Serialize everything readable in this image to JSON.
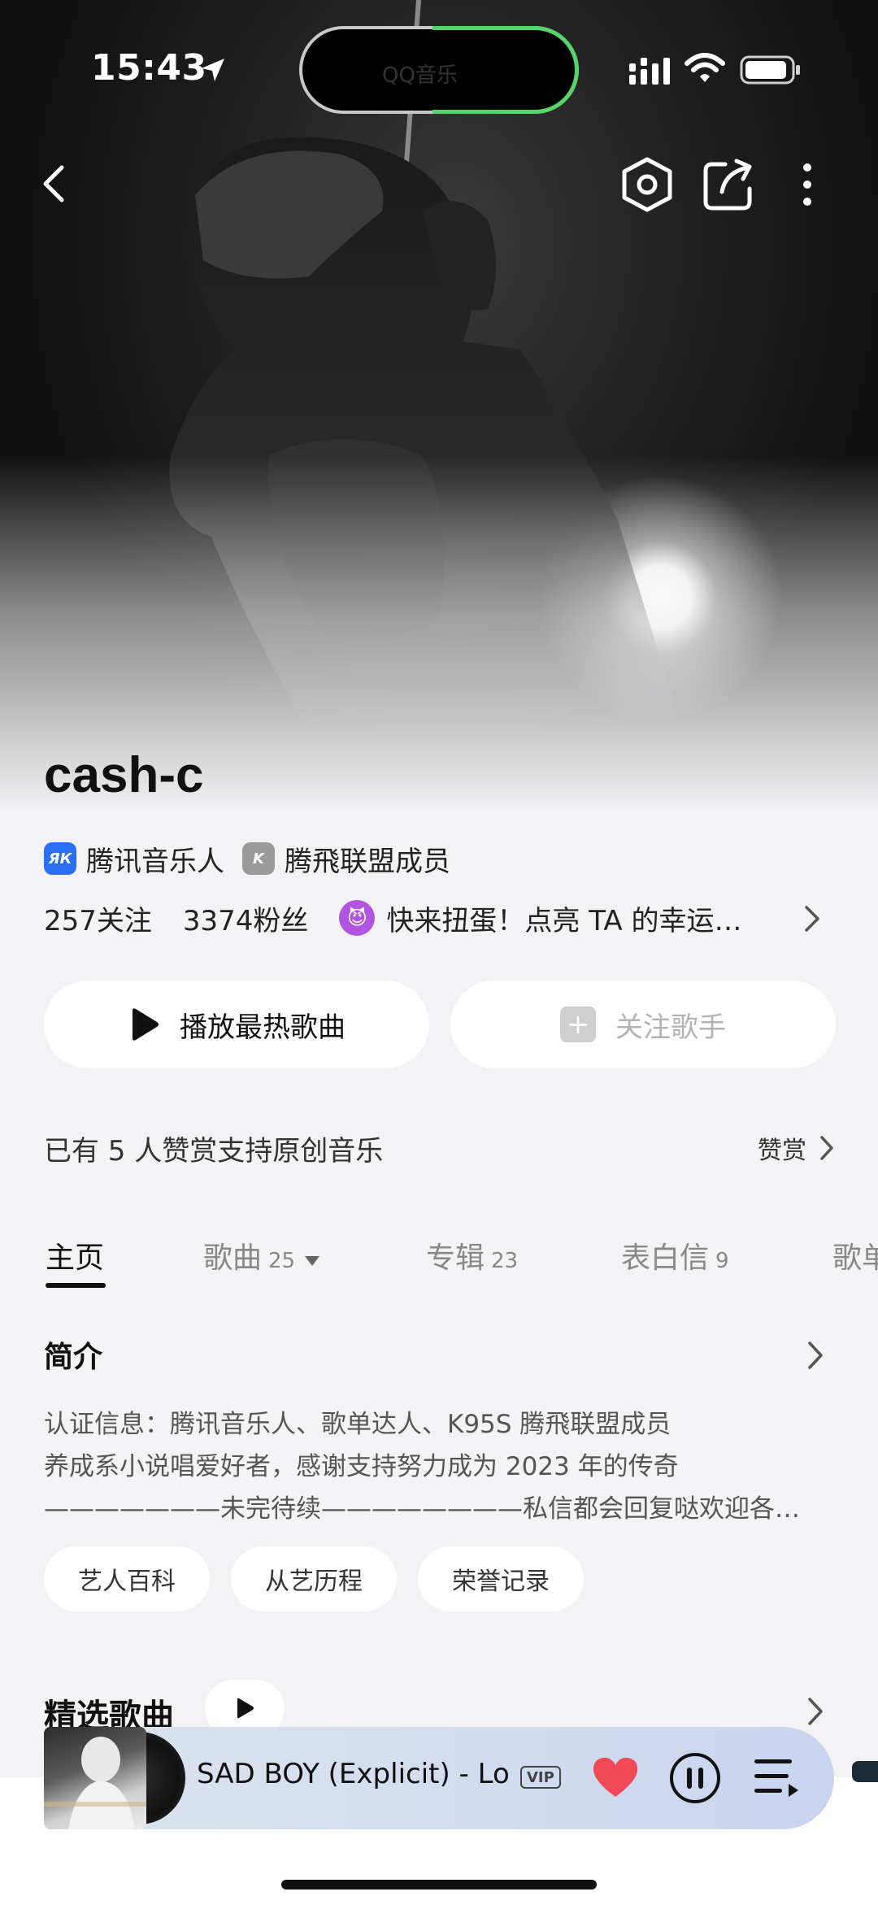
{
  "status_bar": {
    "time": "15:43",
    "island_text": "QQ音乐"
  },
  "nav": {
    "back_icon": "chevron-left-icon",
    "settings_icon": "hexagon-icon",
    "share_icon": "share-icon",
    "more_icon": "more-vertical-icon"
  },
  "artist": {
    "name": "cash-c",
    "badges": [
      {
        "icon_text": "ЯК",
        "label": "腾讯音乐人",
        "color": "#2a6ef5"
      },
      {
        "icon_text": "K",
        "label": "腾飛联盟成员",
        "color": "#9a9a9a"
      }
    ],
    "following": "257关注",
    "followers": "3374粉丝",
    "promo_text": "快来扭蛋！点亮 TA 的幸运…",
    "promo_emoji": "😈"
  },
  "actions": {
    "play_label": "播放最热歌曲",
    "follow_label": "关注歌手"
  },
  "reward": {
    "text": "已有 5 人赞赏支持原创音乐",
    "link": "赞赏"
  },
  "tabs": [
    {
      "label": "主页",
      "count": ""
    },
    {
      "label": "歌曲",
      "count": "25"
    },
    {
      "label": "专辑",
      "count": "23"
    },
    {
      "label": "表白信",
      "count": "9"
    },
    {
      "label": "歌单",
      "count": ""
    }
  ],
  "intro": {
    "title": "简介",
    "lines": [
      "认证信息：腾讯音乐人、歌单达人、K95S 腾飛联盟成员",
      "养成系小说唱爱好者，感谢支持努力成为 2023 年的传奇",
      "———————未完待续————————私信都会回复哒欢迎各位交…"
    ],
    "chips": [
      "艺人百科",
      "从艺历程",
      "荣誉记录"
    ]
  },
  "songs": {
    "title": "精选歌曲"
  },
  "player": {
    "title": "SAD BOY (Explicit) - Lo",
    "vip": "VIP",
    "liked": true,
    "state": "playing"
  }
}
